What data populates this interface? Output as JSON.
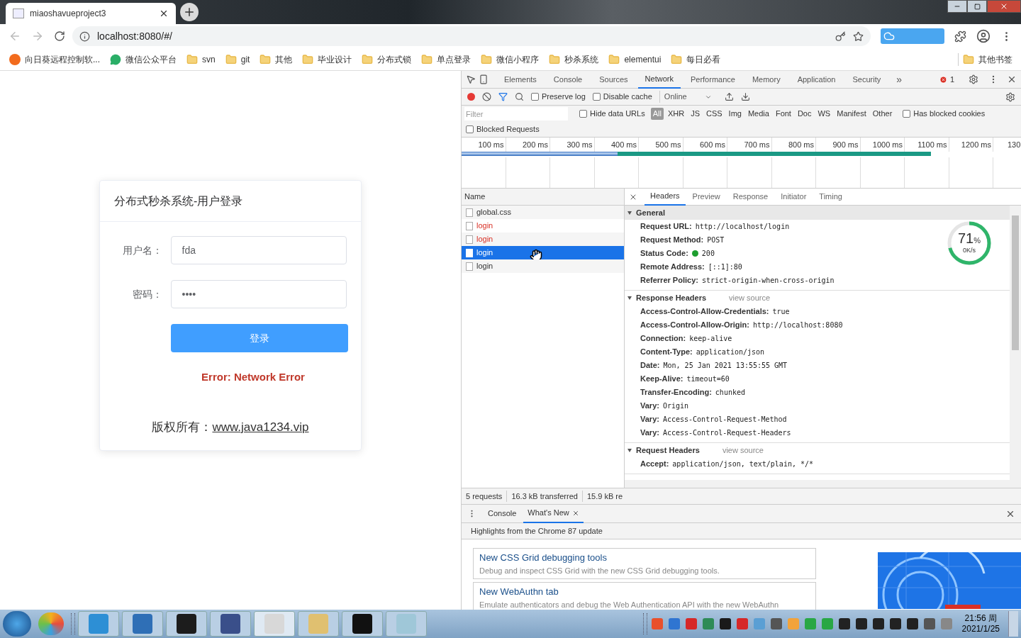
{
  "browser": {
    "tab_title": "miaoshavueproject3",
    "url": "localhost:8080/#/"
  },
  "bookmarks": [
    {
      "kind": "app",
      "label": "向日葵远程控制软..."
    },
    {
      "kind": "chat",
      "label": "微信公众平台"
    },
    {
      "kind": "folder",
      "label": "svn"
    },
    {
      "kind": "folder",
      "label": "git"
    },
    {
      "kind": "folder",
      "label": "其他"
    },
    {
      "kind": "folder",
      "label": "毕业设计"
    },
    {
      "kind": "folder",
      "label": "分布式锁"
    },
    {
      "kind": "folder",
      "label": "单点登录"
    },
    {
      "kind": "folder",
      "label": "微信小程序"
    },
    {
      "kind": "folder",
      "label": "秒杀系统"
    },
    {
      "kind": "folder",
      "label": "elementui"
    },
    {
      "kind": "folder",
      "label": "每日必看"
    }
  ],
  "other_bookmarks": "其他书签",
  "login": {
    "title": "分布式秒杀系统-用户登录",
    "fields": [
      {
        "label": "用户名：",
        "value": "fda"
      },
      {
        "label": "密码：",
        "value": "••••"
      }
    ],
    "submit": "登录",
    "error": "Error: Network Error",
    "copyright": "版权所有：",
    "link": "www.java1234.vip"
  },
  "devtools": {
    "tabs": [
      {
        "label": "Elements",
        "selected": false
      },
      {
        "label": "Console",
        "selected": false
      },
      {
        "label": "Sources",
        "selected": false
      },
      {
        "label": "Network",
        "selected": true
      },
      {
        "label": "Performance",
        "selected": false
      },
      {
        "label": "Memory",
        "selected": false
      },
      {
        "label": "Application",
        "selected": false
      },
      {
        "label": "Security",
        "selected": false
      }
    ],
    "more": "»",
    "error_count": "1",
    "toolbar": {
      "recording": true,
      "preserve_log": {
        "label": "Preserve log",
        "checked": false
      },
      "disable_cache": {
        "label": "Disable cache",
        "checked": false
      },
      "throttle": "Online"
    },
    "filter": {
      "placeholder": "Filter",
      "hide_data_urls": {
        "label": "Hide data URLs",
        "checked": false
      },
      "types": [
        {
          "label": "All",
          "selected": true
        },
        {
          "label": "XHR",
          "selected": false
        },
        {
          "label": "JS",
          "selected": false
        },
        {
          "label": "CSS",
          "selected": false
        },
        {
          "label": "Img",
          "selected": false
        },
        {
          "label": "Media",
          "selected": false
        },
        {
          "label": "Font",
          "selected": false
        },
        {
          "label": "Doc",
          "selected": false
        },
        {
          "label": "WS",
          "selected": false
        },
        {
          "label": "Manifest",
          "selected": false
        },
        {
          "label": "Other",
          "selected": false
        }
      ],
      "has_blocked_cookies": {
        "label": "Has blocked cookies",
        "checked": false
      },
      "blocked_requests": {
        "label": "Blocked Requests",
        "checked": false
      }
    },
    "timeline": {
      "ticks": [
        "100 ms",
        "200 ms",
        "300 ms",
        "400 ms",
        "500 ms",
        "600 ms",
        "700 ms",
        "800 ms",
        "900 ms",
        "1000 ms",
        "1100 ms",
        "1200 ms",
        "130"
      ]
    },
    "requests": {
      "column": "Name",
      "items": [
        {
          "name": "global.css",
          "failed": false,
          "selected": false
        },
        {
          "name": "login",
          "failed": true,
          "selected": false
        },
        {
          "name": "login",
          "failed": true,
          "selected": false
        },
        {
          "name": "login",
          "failed": false,
          "selected": true
        },
        {
          "name": "login",
          "failed": false,
          "selected": false
        }
      ]
    },
    "detail": {
      "tabs": [
        {
          "label": "Headers",
          "selected": true
        },
        {
          "label": "Preview",
          "selected": false
        },
        {
          "label": "Response",
          "selected": false
        },
        {
          "label": "Initiator",
          "selected": false
        },
        {
          "label": "Timing",
          "selected": false
        }
      ],
      "sections": [
        {
          "title": "General",
          "rows": [
            {
              "kind": "text",
              "name": "Request URL:",
              "value": "http://localhost/login"
            },
            {
              "kind": "text",
              "name": "Request Method:",
              "value": "POST"
            },
            {
              "kind": "status",
              "name": "Status Code:",
              "value": "200"
            },
            {
              "kind": "text",
              "name": "Remote Address:",
              "value": "[::1]:80"
            },
            {
              "kind": "text",
              "name": "Referrer Policy:",
              "value": "strict-origin-when-cross-origin"
            }
          ]
        },
        {
          "title": "Response Headers",
          "view_source": "view source",
          "rows": [
            {
              "kind": "text",
              "name": "Access-Control-Allow-Credentials:",
              "value": "true"
            },
            {
              "kind": "text",
              "name": "Access-Control-Allow-Origin:",
              "value": "http://localhost:8080"
            },
            {
              "kind": "text",
              "name": "Connection:",
              "value": "keep-alive"
            },
            {
              "kind": "text",
              "name": "Content-Type:",
              "value": "application/json"
            },
            {
              "kind": "text",
              "name": "Date:",
              "value": "Mon, 25 Jan 2021 13:55:55 GMT"
            },
            {
              "kind": "text",
              "name": "Keep-Alive:",
              "value": "timeout=60"
            },
            {
              "kind": "text",
              "name": "Transfer-Encoding:",
              "value": "chunked"
            },
            {
              "kind": "text",
              "name": "Vary:",
              "value": "Origin"
            },
            {
              "kind": "text",
              "name": "Vary:",
              "value": "Access-Control-Request-Method"
            },
            {
              "kind": "text",
              "name": "Vary:",
              "value": "Access-Control-Request-Headers"
            }
          ]
        },
        {
          "title": "Request Headers",
          "view_source": "view source",
          "rows": [
            {
              "kind": "text",
              "name": "Accept:",
              "value": "application/json, text/plain, */*"
            }
          ]
        }
      ]
    },
    "gauge": {
      "level": 0.71,
      "value": "71",
      "unit": "%",
      "speed": "0K/s"
    },
    "footer": [
      "5 requests",
      "16.3 kB transferred",
      "15.9 kB re"
    ],
    "drawer": {
      "tabs": [
        {
          "label": "Console",
          "selected": false,
          "closable": false
        },
        {
          "label": "What's New",
          "selected": true,
          "closable": true
        }
      ],
      "headline": "Highlights from the Chrome 87 update",
      "cards": [
        {
          "title": "New CSS Grid debugging tools",
          "text": "Debug and inspect CSS Grid with the new CSS Grid debugging tools."
        },
        {
          "title": "New WebAuthn tab",
          "text": "Emulate authenticators and debug the Web Authentication API with the new WebAuthn"
        }
      ]
    }
  },
  "taskbar": {
    "time": "21:56 周",
    "date": "2021/1/25"
  }
}
